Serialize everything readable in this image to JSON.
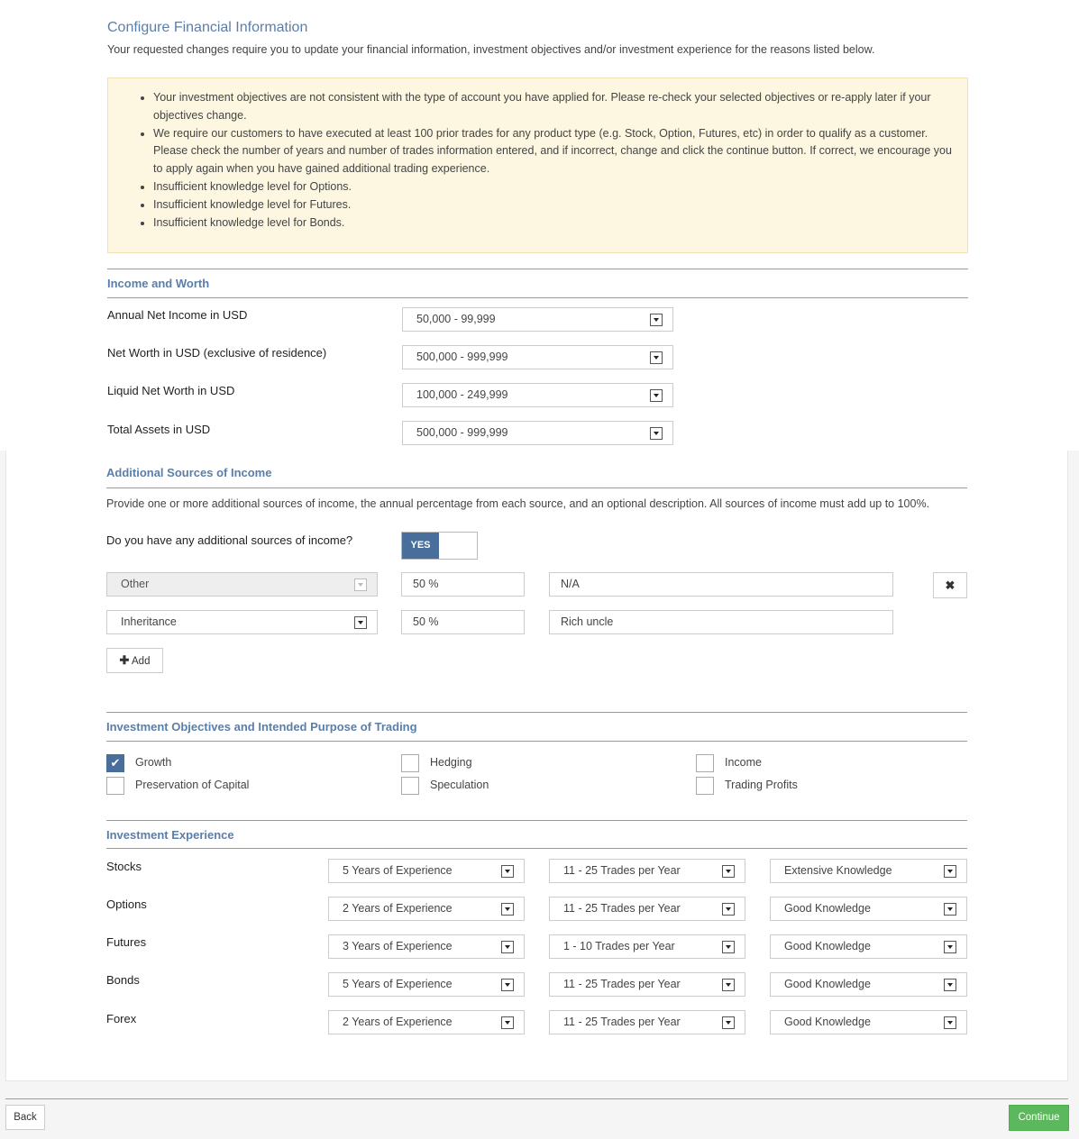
{
  "header": {
    "title": "Configure Financial Information",
    "subtitle": "Your requested changes require you to update your financial information, investment objectives and/or investment experience for the reasons listed below."
  },
  "warnings": [
    "Your investment objectives are not consistent with the type of account you have applied for. Please re-check your selected objectives or re-apply later if your objectives change.",
    "We require our customers to have executed at least 100 prior trades for any product type (e.g. Stock, Option, Futures, etc) in order to qualify as a customer. Please check the number of years and number of trades information entered, and if incorrect, change and click the continue button. If correct, we encourage you to apply again when you have gained additional trading experience.",
    "Insufficient knowledge level for Options.",
    "Insufficient knowledge level for Futures.",
    "Insufficient knowledge level for Bonds."
  ],
  "income_worth": {
    "heading": "Income and Worth",
    "rows": [
      {
        "label": "Annual Net Income in USD",
        "value": "50,000 - 99,999"
      },
      {
        "label": "Net Worth in USD (exclusive of residence)",
        "value": "500,000 - 999,999"
      },
      {
        "label": "Liquid Net Worth in USD",
        "value": "100,000 - 249,999"
      },
      {
        "label": "Total Assets in USD",
        "value": "500,000 - 999,999"
      }
    ]
  },
  "additional_income": {
    "heading": "Additional Sources of Income",
    "description": "Provide one or more additional sources of income, the annual percentage from each source, and an optional description. All sources of income must add up to 100%.",
    "question": "Do you have any additional sources of income?",
    "toggle_label": "YES",
    "toggle_on": true,
    "sources": [
      {
        "type": "Other",
        "percent": "50 %",
        "description": "N/A",
        "disabled": true
      },
      {
        "type": "Inheritance",
        "percent": "50 %",
        "description": "Rich uncle",
        "disabled": false
      }
    ],
    "remove_icon": "close-icon",
    "add_label": "Add",
    "add_icon": "plus-icon"
  },
  "objectives": {
    "heading": "Investment Objectives and Intended Purpose of Trading",
    "items": [
      {
        "label": "Growth",
        "checked": true
      },
      {
        "label": "Hedging",
        "checked": false
      },
      {
        "label": "Income",
        "checked": false
      },
      {
        "label": "Preservation of Capital",
        "checked": false
      },
      {
        "label": "Speculation",
        "checked": false
      },
      {
        "label": "Trading Profits",
        "checked": false
      }
    ]
  },
  "experience": {
    "heading": "Investment Experience",
    "rows": [
      {
        "product": "Stocks",
        "years": "5 Years of Experience",
        "trades": "11 - 25 Trades per Year",
        "knowledge": "Extensive Knowledge"
      },
      {
        "product": "Options",
        "years": "2 Years of Experience",
        "trades": "11 - 25 Trades per Year",
        "knowledge": "Good Knowledge"
      },
      {
        "product": "Futures",
        "years": "3 Years of Experience",
        "trades": "1 - 10 Trades per Year",
        "knowledge": "Good Knowledge"
      },
      {
        "product": "Bonds",
        "years": "5 Years of Experience",
        "trades": "11 - 25 Trades per Year",
        "knowledge": "Good Knowledge"
      },
      {
        "product": "Forex",
        "years": "2 Years of Experience",
        "trades": "11 - 25 Trades per Year",
        "knowledge": "Good Knowledge"
      }
    ]
  },
  "footer": {
    "back_label": "Back",
    "continue_label": "Continue"
  },
  "colors": {
    "heading": "#5b7ea8",
    "toggle_active": "#496e9b",
    "continue": "#5cb85c",
    "warning_bg": "#fdf7e1"
  }
}
